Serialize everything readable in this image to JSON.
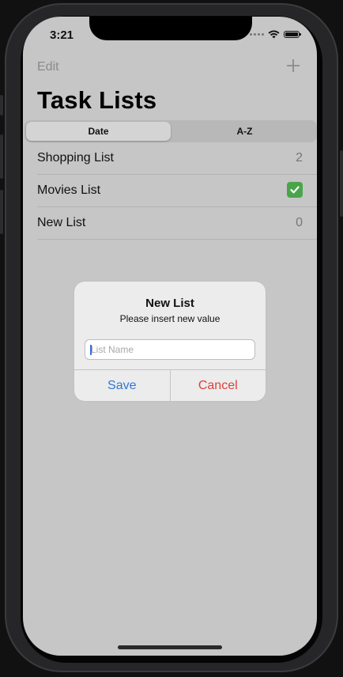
{
  "status_bar": {
    "time": "3:21"
  },
  "nav": {
    "edit_label": "Edit",
    "add_icon": "plus-icon"
  },
  "title": "Task Lists",
  "segmented": {
    "options": [
      "Date",
      "A-Z"
    ],
    "selected": "Date"
  },
  "lists": [
    {
      "name": "Shopping List",
      "count": "2"
    },
    {
      "name": "Movies List",
      "status": "complete-checkmark-icon"
    },
    {
      "name": "New List",
      "count": "0"
    }
  ],
  "alert": {
    "title": "New List",
    "message": "Please insert new value",
    "input_value": "",
    "input_placeholder": "List Name",
    "save_label": "Save",
    "cancel_label": "Cancel"
  },
  "colors": {
    "dimmed_background": "#c6c6c6",
    "accent_blue": "#2f79d6",
    "destructive_red": "#e0403a",
    "checkmark_green": "#4aa54a"
  }
}
